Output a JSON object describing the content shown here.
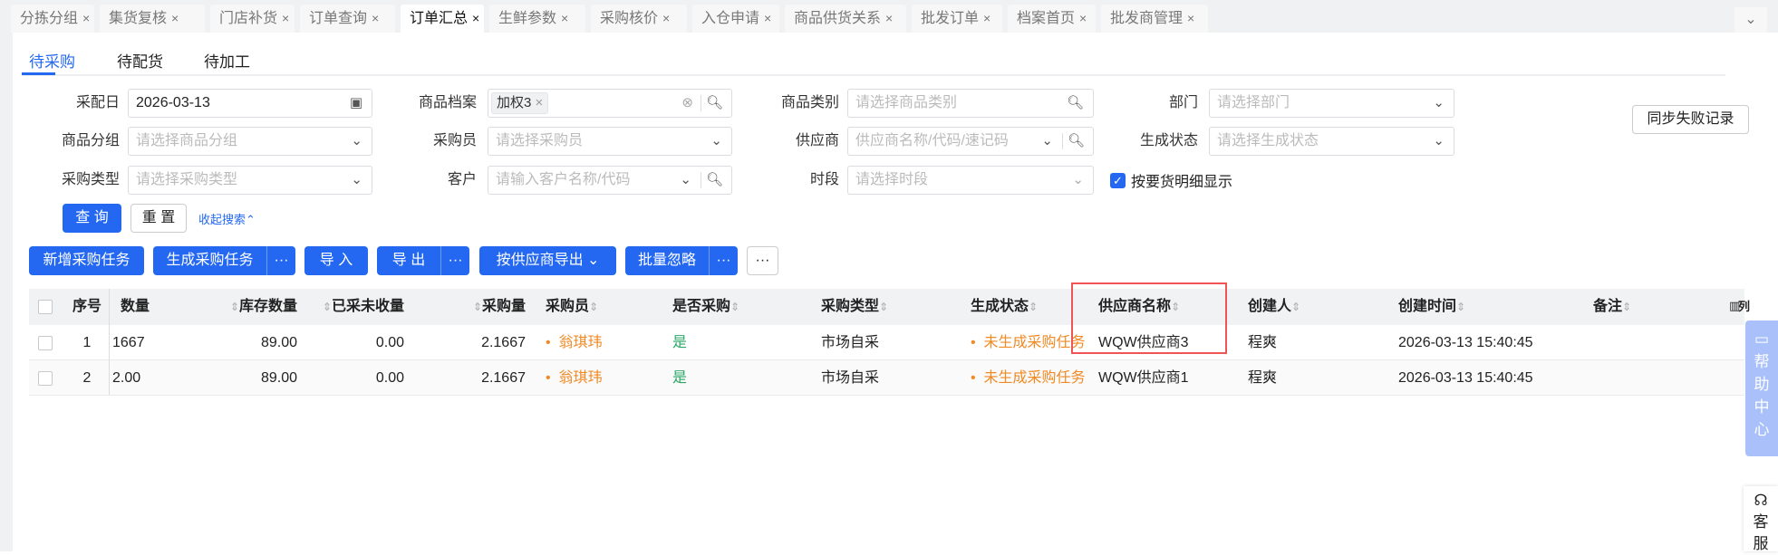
{
  "tabs": [
    {
      "label": "分拣分组"
    },
    {
      "label": "集货复核"
    },
    {
      "label": "门店补货"
    },
    {
      "label": "订单查询"
    },
    {
      "label": "订单汇总",
      "active": true
    },
    {
      "label": "生鲜参数"
    },
    {
      "label": "采购核价"
    },
    {
      "label": "入仓申请"
    },
    {
      "label": "商品供货关系"
    },
    {
      "label": "批发订单"
    },
    {
      "label": "档案首页"
    },
    {
      "label": "批发商管理"
    }
  ],
  "tab_close": "×",
  "subtabs": [
    "待采购",
    "待配货",
    "待加工"
  ],
  "filters": {
    "date_label": "采配日",
    "date_value": "2026-03-13",
    "goods_label": "商品档案",
    "goods_chip": "加权3",
    "category_label": "商品类别",
    "category_ph": "请选择商品类别",
    "dept_label": "部门",
    "dept_ph": "请选择部门",
    "group_label": "商品分组",
    "group_ph": "请选择商品分组",
    "buyer_label": "采购员",
    "buyer_ph": "请选择采购员",
    "supplier_label": "供应商",
    "supplier_ph": "供应商名称/代码/速记码",
    "genstatus_label": "生成状态",
    "genstatus_ph": "请选择生成状态",
    "ptype_label": "采购类型",
    "ptype_ph": "请选择采购类型",
    "customer_label": "客户",
    "customer_ph": "请输入客户名称/代码",
    "period_label": "时段",
    "period_ph": "请选择时段",
    "detail_checkbox": "按要货明细显示"
  },
  "sync_fail": "同步失败记录",
  "query": "查 询",
  "reset": "重 置",
  "collapse": "收起搜索",
  "actions": {
    "add": "新增采购任务",
    "gen": "生成采购任务",
    "import": "导 入",
    "export": "导 出",
    "export_supplier": "按供应商导出",
    "ignore": "批量忽略",
    "more": "···"
  },
  "columns": [
    "序号",
    "数量",
    "库存数量",
    "已采未收量",
    "采购量",
    "采购员",
    "是否采购",
    "采购类型",
    "生成状态",
    "供应商名称",
    "创建人",
    "创建时间",
    "备注",
    "列"
  ],
  "rows": [
    {
      "no": "1",
      "qty": "1667",
      "stock": "89.00",
      "unrecv": "0.00",
      "pqty": "2.1667",
      "buyer": "翁琪玮",
      "is": "是",
      "ptype": "市场自采",
      "status": "未生成采购任务",
      "supplier": "WQW供应商3",
      "creator": "程爽",
      "time": "2026-03-13 15:40:45",
      "remark": ""
    },
    {
      "no": "2",
      "qty": "2.00",
      "stock": "89.00",
      "unrecv": "0.00",
      "pqty": "2.1667",
      "buyer": "翁琪玮",
      "is": "是",
      "ptype": "市场自采",
      "status": "未生成采购任务",
      "supplier": "WQW供应商1",
      "creator": "程爽",
      "time": "2026-03-13 15:40:45",
      "remark": ""
    }
  ],
  "help": [
    "帮",
    "助",
    "中",
    "心"
  ],
  "kefu": [
    "客",
    "服"
  ]
}
